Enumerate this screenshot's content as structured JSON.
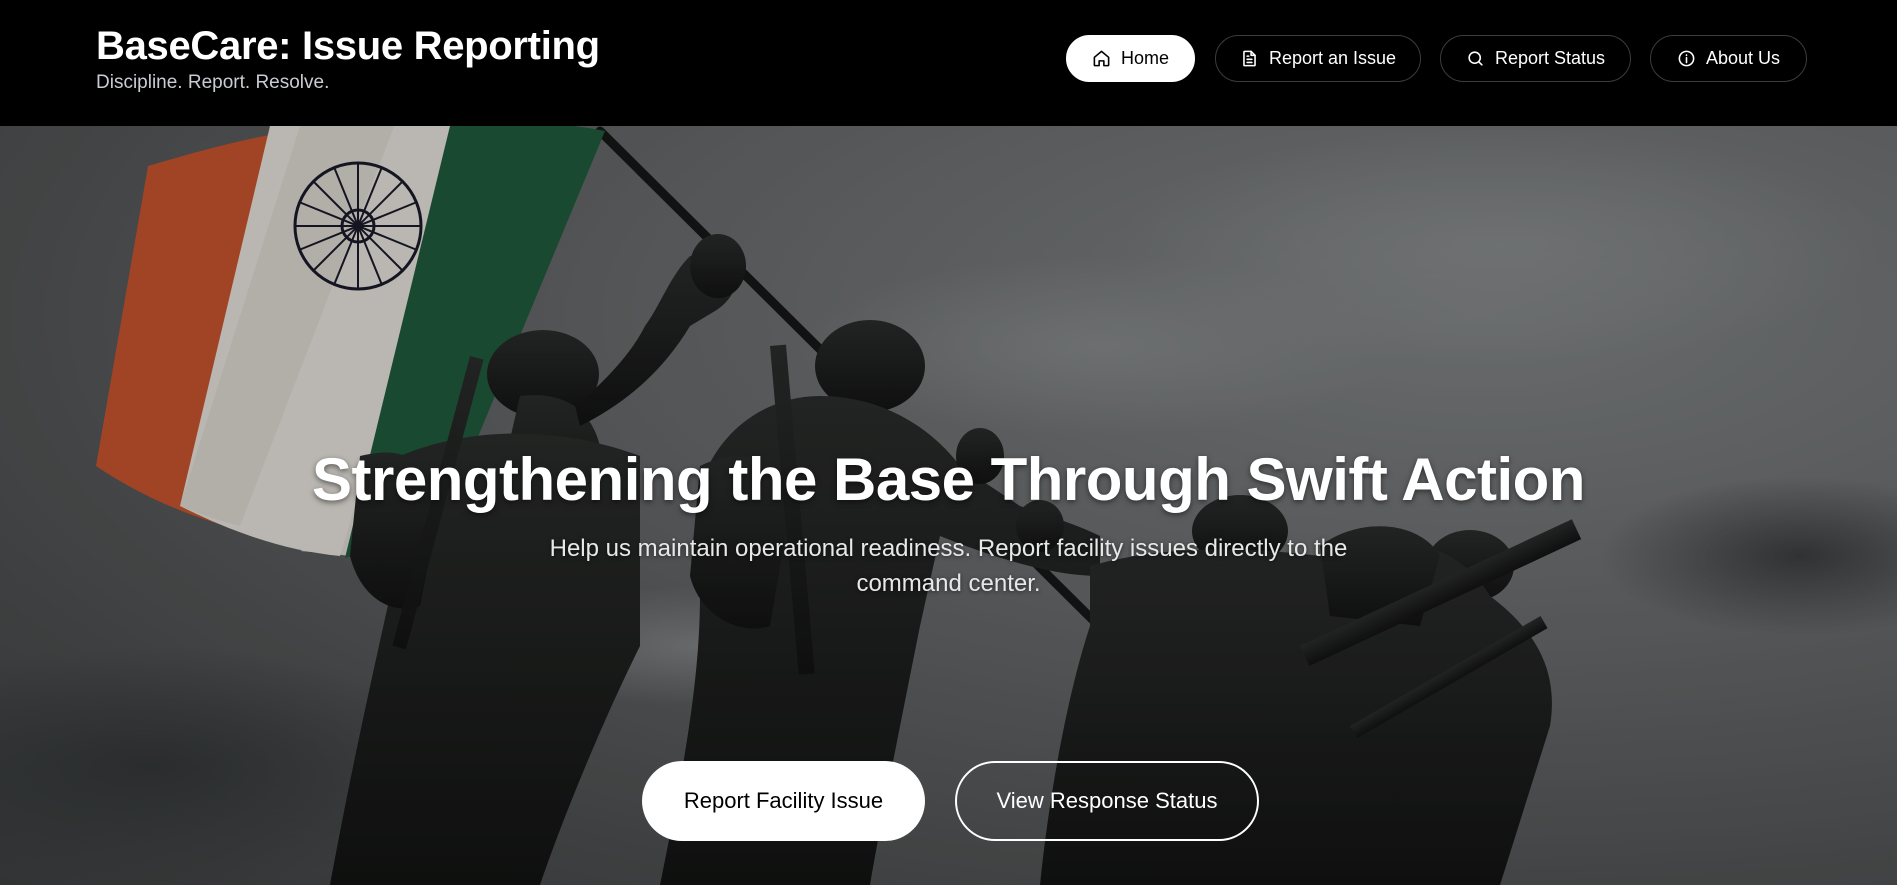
{
  "header": {
    "title": "BaseCare: Issue Reporting",
    "tagline": "Discipline. Report. Resolve.",
    "nav": [
      {
        "label": "Home",
        "icon": "home-icon",
        "active": true
      },
      {
        "label": "Report an Issue",
        "icon": "document-icon",
        "active": false
      },
      {
        "label": "Report Status",
        "icon": "search-icon",
        "active": false
      },
      {
        "label": "About Us",
        "icon": "info-icon",
        "active": false
      }
    ]
  },
  "hero": {
    "heading": "Strengthening the Base Through Swift Action",
    "subheading": "Help us maintain operational readiness. Report facility issues directly to the command center.",
    "primary_button": "Report Facility Issue",
    "secondary_button": "View Response Status"
  },
  "colors": {
    "header_bg": "#000000",
    "accent": "#ffffff",
    "flag_saffron": "#c4532e",
    "flag_white": "#e6e2dc",
    "flag_green": "#1f5a3c",
    "chakra": "#1a1a2a"
  }
}
